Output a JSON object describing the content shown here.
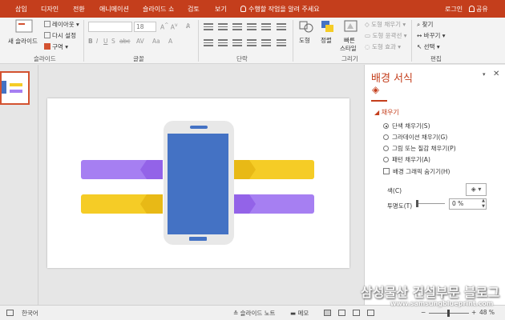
{
  "ribbon_tabs": [
    "삽입",
    "디자인",
    "전환",
    "애니메이션",
    "슬라이드 쇼",
    "검토",
    "보기"
  ],
  "tell_me": "수행할 작업을 알려 주세요",
  "login": "로그인",
  "share": "공유",
  "ribbon": {
    "new_slide": "새 슬라이드",
    "layout": "레이아웃",
    "reset": "다시 설정",
    "section": "구역",
    "font_size": "18",
    "shape": "도형",
    "arrange": "정렬",
    "quick_style_1": "빠른",
    "quick_style_2": "스타일",
    "shape_fill": "도형 채우기",
    "shape_outline": "도형 윤곽선",
    "shape_effects": "도형 효과",
    "find": "찾기",
    "replace": "바꾸기",
    "select": "선택",
    "groups": {
      "slides": "슬라이드",
      "font": "글꼴",
      "paragraph": "단락",
      "drawing": "그리기",
      "editing": "편집"
    }
  },
  "format_pane": {
    "title": "배경 서식",
    "section": "채우기",
    "options": [
      {
        "label": "단색 채우기(S)",
        "selected": true
      },
      {
        "label": "그라데이션 채우기(G)",
        "selected": false
      },
      {
        "label": "그림 또는 질감 채우기(P)",
        "selected": false
      },
      {
        "label": "패턴 채우기(A)",
        "selected": false
      }
    ],
    "hide_graphics": "배경 그래픽 숨기기(H)",
    "color_label": "색(C)",
    "transparency_label": "투명도(T)",
    "transparency_value": "0 %"
  },
  "status": {
    "language": "한국어",
    "notes": "슬라이드 노트",
    "comments": "메모",
    "zoom": "48 %"
  },
  "watermark": {
    "line1": "삼성물산 건설부문 블로그",
    "line2": "www.samsungblueprint.com"
  },
  "colors": {
    "accent": "#c43e1c",
    "phone_body": "#e8e8e8",
    "phone_screen": "#4472c4",
    "purple": "#a67ff2",
    "purple_dark": "#9363e8",
    "yellow": "#f5cc26",
    "yellow_dark": "#e8b916"
  }
}
